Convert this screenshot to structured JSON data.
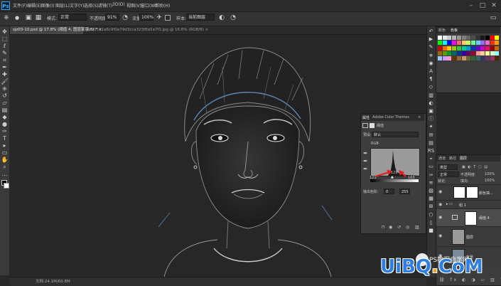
{
  "app": {
    "logo": "Ps",
    "menus": [
      "文件(F)",
      "编辑(E)",
      "图像(I)",
      "图层(L)",
      "文字(Y)",
      "选择(S)",
      "滤镜(T)",
      "3D(D)",
      "视图(V)",
      "窗口(W)",
      "帮助(H)"
    ],
    "window_controls": [
      "–",
      "□",
      "✕"
    ]
  },
  "options_bar": {
    "mode_label": "模式:",
    "mode_value": "正常",
    "opacity_label": "不透明度:",
    "opacity_value": "91%",
    "flow_label": "流量:",
    "flow_value": "100%",
    "sample_label": "样本:",
    "sample_value": "当前图层"
  },
  "document_tabs": [
    {
      "label": "sjz03-10.psd @ 17.8% (阈值 4, 图层蒙版/8) *",
      "close": "×"
    },
    {
      "label": "6c91531a6c9f0e79d3cca323f8a5a7f3.jpg @ 16.6% (RGB/8)",
      "close": "×"
    }
  ],
  "status_bar": {
    "text": "文档:24.1M/60.8M"
  },
  "swatches_panel": {
    "tabs": [
      "颜色",
      "色板"
    ],
    "colors": [
      "#ffffff",
      "#e6e6e6",
      "#cccccc",
      "#b3b3b3",
      "#999999",
      "#808080",
      "#666666",
      "#4d4d4d",
      "#333333",
      "#1a1a1a",
      "#000000",
      "#ff0000",
      "#ffff00",
      "#00ff00",
      "#00ffff",
      "#0000ff",
      "#ff00ff",
      "#ff6666",
      "#ffcc66",
      "#ccff66",
      "#66ff99",
      "#66ccff",
      "#9966ff",
      "#ff66cc",
      "#ff3300",
      "#ff9900",
      "#cc0000",
      "#ff6600",
      "#ffcc00",
      "#99cc00",
      "#33cc33",
      "#00cc99",
      "#0099cc",
      "#0033cc",
      "#6600cc",
      "#cc00cc",
      "#ff0066",
      "#990000",
      "#cc6600",
      "#996600",
      "#669900",
      "#009933",
      "#006666",
      "#003399",
      "#330099",
      "#660066",
      "#990033",
      "#ff9999",
      "#ffcc99",
      "#ffff99",
      "#ccffcc",
      "#99ffff",
      "#99ccff",
      "#cc99ff",
      "#ff99cc",
      "#663300",
      "#996633",
      "#cc9966",
      "#666633",
      "#336633",
      "#336666",
      "#333366",
      "#663366",
      "#993366",
      "#4d2600"
    ]
  },
  "properties_panel": {
    "tabs": [
      "属性",
      "Adobe Color Themes"
    ],
    "title": "阈值",
    "preset_label": "预设:",
    "preset_value": "默认",
    "channel_value": "RGB",
    "input_low": "123",
    "input_mid": "128",
    "input_high": "163",
    "output_label": "输出色阶:",
    "output_low": "0",
    "output_high": "255"
  },
  "layers_panel": {
    "tabs": [
      "通道",
      "路径",
      "图层"
    ],
    "kind_label": "类型",
    "blend_value": "正常",
    "opacity_label": "不透明度:",
    "opacity_value": "100%",
    "lock_label": "锁定:",
    "fill_label": "填充:",
    "fill_value": "100%",
    "layers": [
      {
        "name": "颜色填...",
        "kind": "fill"
      },
      {
        "name": "组 1",
        "kind": "group"
      },
      {
        "name": "阈值 4",
        "kind": "threshold"
      },
      {
        "name": "图层",
        "kind": "layer"
      },
      {
        "name": "背景",
        "kind": "background"
      }
    ]
  },
  "watermark": {
    "subtitle": "PS教程自学网",
    "brand_a": "UiBQ",
    "brand_dot": ".",
    "brand_b": "CoM"
  },
  "colors": {
    "accent": "#31a8ff",
    "annotation_arrow": "#e02020",
    "watermark_blue": "#2f7fe0"
  }
}
